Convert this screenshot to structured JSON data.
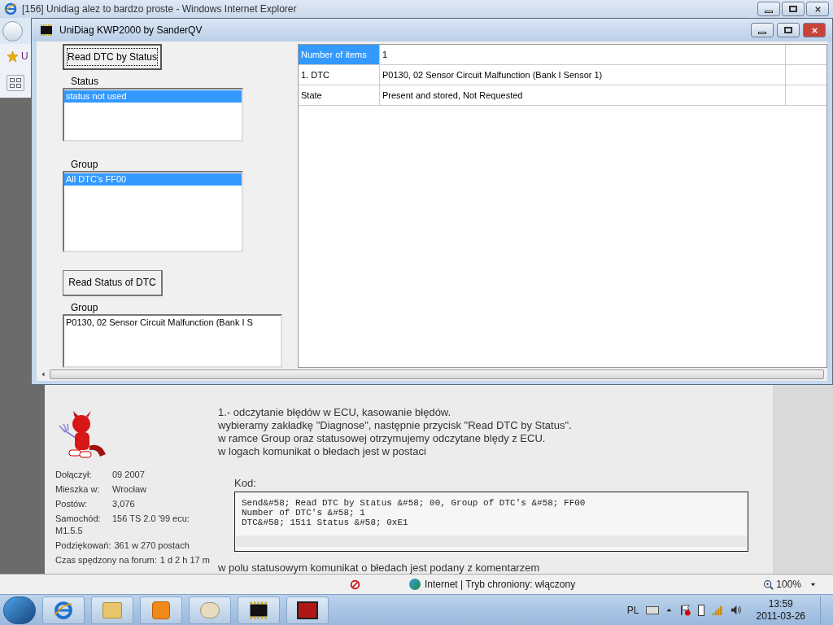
{
  "browser": {
    "title": "[156] Unidiag alez to bardzo proste - Windows Internet Explorer",
    "favorites_text": "U"
  },
  "app_window": {
    "title": "UniDiag KWP2000 by SanderQV",
    "read_dtc_button": "Read DTC by Status",
    "status_list": {
      "label": "Status",
      "items": [
        {
          "text": "status not used",
          "selected": true
        }
      ]
    },
    "group_list": {
      "label": "Group",
      "items": [
        {
          "text": "All DTC's FF00",
          "selected": true
        }
      ]
    },
    "read_status_button": "Read Status of DTC",
    "result_list": {
      "label": "Group",
      "items": [
        {
          "text": "P0130, 02 Sensor Circuit Malfunction (Bank I S",
          "selected": false
        }
      ]
    },
    "table": {
      "rows": [
        {
          "label": "Number of items",
          "value": "1",
          "selected": true
        },
        {
          "label": "1. DTC",
          "value": "P0130, 02 Sensor Circuit Malfunction (Bank I Sensor 1)",
          "selected": false
        },
        {
          "label": "State",
          "value": "Present and stored, Not Requested",
          "selected": false
        }
      ]
    }
  },
  "post": {
    "profile": [
      {
        "label": "Dołączył:",
        "value": "09 2007"
      },
      {
        "label": "Mieszka w:",
        "value": "Wrocław"
      },
      {
        "label": "Postów:",
        "value": "3,076"
      },
      {
        "label": "Samochód:",
        "value": "156 TS 2.0 '99 ecu: M1.5.5"
      },
      {
        "label": "Podziękowań:",
        "value": "361 w 270 postach"
      },
      {
        "label": "Czas spędzony na forum:",
        "value": "1 d 2 h 17 m"
      }
    ],
    "paragraphs": [
      "1.- odczytanie błędów w ECU, kasowanie błędów.",
      "wybieramy zakładkę \"Diagnose\", następnie przycisk \"Read DTC by Status\".",
      "w ramce Group oraz statusowej otrzymujemy odczytane blędy z ECU.",
      "w logach komunikat o błedach jest w postaci"
    ],
    "code": {
      "label": "Kod:",
      "lines": [
        "Send&#58; Read DTC by Status &#58; 00, Group of DTC's &#58; FF00",
        "Number of DTC's &#58; 1",
        "DTC&#58; 1511 Status &#58; 0xE1"
      ]
    },
    "trailing_text": "w polu statusowym komunikat o błedach jest podany z komentarzem"
  },
  "status_bar": {
    "zone": "Internet | Tryb chroniony: włączony",
    "zoom": "100%"
  },
  "taskbar": {
    "language": "PL",
    "time": "13:59",
    "date": "2011-03-26"
  }
}
